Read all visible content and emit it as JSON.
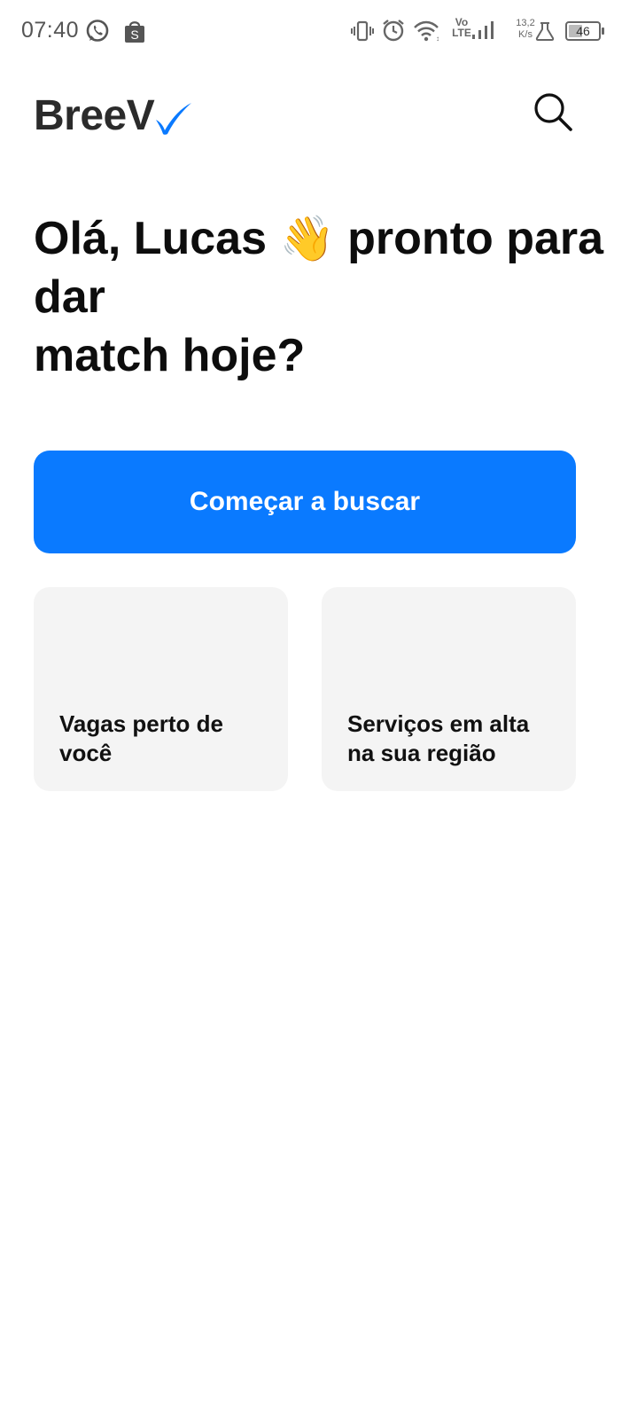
{
  "status_bar": {
    "time": "07:40",
    "net_speed_value": "13,2",
    "net_speed_unit": "K/s",
    "lte_top": "Vo",
    "lte_bottom": "LTE",
    "battery": "46",
    "battery_level": 0.46,
    "icons": [
      "whatsapp-icon",
      "shopee-icon",
      "vibrate-icon",
      "alarm-icon",
      "wifi-icon",
      "signal-icon",
      "flask-icon",
      "battery-icon"
    ]
  },
  "header": {
    "logo_text": "BreeV",
    "logo_mark": "check-mark-icon",
    "search_icon": "search-icon"
  },
  "greeting": {
    "line1_pre": "Olá, Lucas",
    "emoji": "👋",
    "line1_post": "pronto para",
    "line2": "dar",
    "line3": "match hoje?"
  },
  "cta": {
    "label": "Começar a buscar"
  },
  "cards": [
    {
      "title": "Vagas perto de você"
    },
    {
      "title": "Serviços em alta na sua região"
    }
  ],
  "colors": {
    "accent": "#0a7aff",
    "card_bg": "#f4f4f4",
    "text": "#111111"
  }
}
